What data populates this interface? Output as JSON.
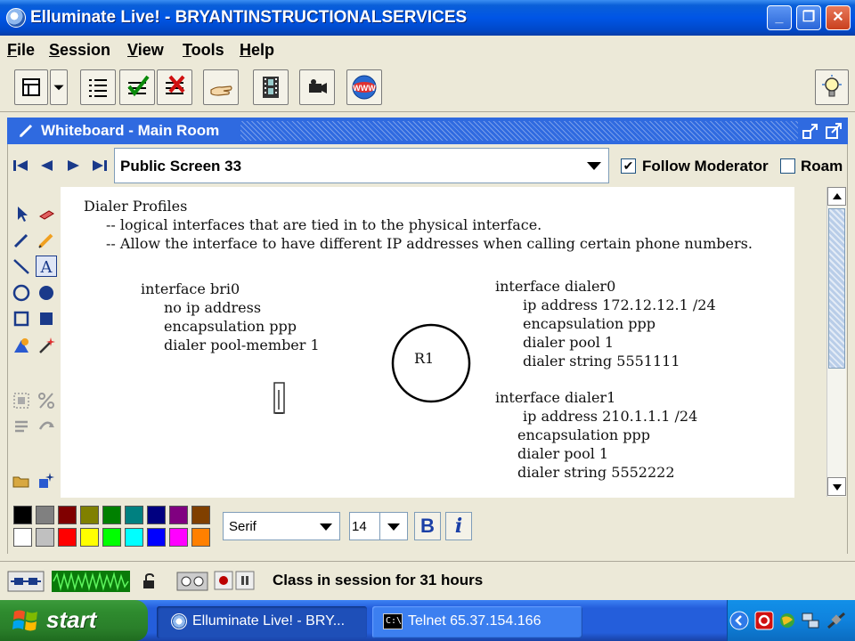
{
  "window": {
    "title": "Elluminate Live! - BRYANTINSTRUCTIONALSERVICES"
  },
  "menu": [
    "File",
    "Session",
    "View",
    "Tools",
    "Help"
  ],
  "toolbar": {
    "icons": [
      "layout-icon",
      "layout-dropdown-icon",
      "list-icon",
      "check-list-icon",
      "x-list-icon",
      "hand-icon",
      "film-icon",
      "camera-icon",
      "www-icon",
      "lightbulb-icon"
    ],
    "www_label": "WWW"
  },
  "whiteboard": {
    "header_title": "Whiteboard - Main Room",
    "screen_name": "Public Screen 33",
    "follow_moderator": {
      "label": "Follow Moderator",
      "checked": true
    },
    "roam": {
      "label": "Roam",
      "checked": false
    }
  },
  "canvas": {
    "heading": "Dialer Profiles",
    "bullets": [
      "-- logical interfaces that are tied in to the physical interface.",
      "-- Allow the interface to have different IP addresses when calling certain phone numbers."
    ],
    "bri_config": [
      "interface bri0",
      "no ip address",
      "encapsulation ppp",
      "dialer pool-member 1"
    ],
    "router_label": "R1",
    "dialer0_config": [
      "interface dialer0",
      "ip address 172.12.12.1 /24",
      "encapsulation ppp",
      "dialer pool 1",
      "dialer string 5551111"
    ],
    "dialer1_config": [
      "interface dialer1",
      "ip address 210.1.1.1 /24",
      "encapsulation ppp",
      "dialer pool 1",
      "dialer string 5552222"
    ]
  },
  "palette": {
    "colors_row1": [
      "#000000",
      "#808080",
      "#800000",
      "#808000",
      "#008000",
      "#008080",
      "#000080",
      "#800080",
      "#804000"
    ],
    "colors_row2": [
      "#ffffff",
      "#c0c0c0",
      "#ff0000",
      "#ffff00",
      "#00ff00",
      "#00ffff",
      "#0000ff",
      "#ff00ff",
      "#ff8000"
    ],
    "font": "Serif",
    "size": "14",
    "bold_label": "B",
    "italic_label": "i"
  },
  "status": {
    "text": "Class in session for 31 hours"
  },
  "taskbar": {
    "start_label": "start",
    "tasks": [
      "Elluminate Live! - BRY...",
      "Telnet 65.37.154.166"
    ]
  }
}
